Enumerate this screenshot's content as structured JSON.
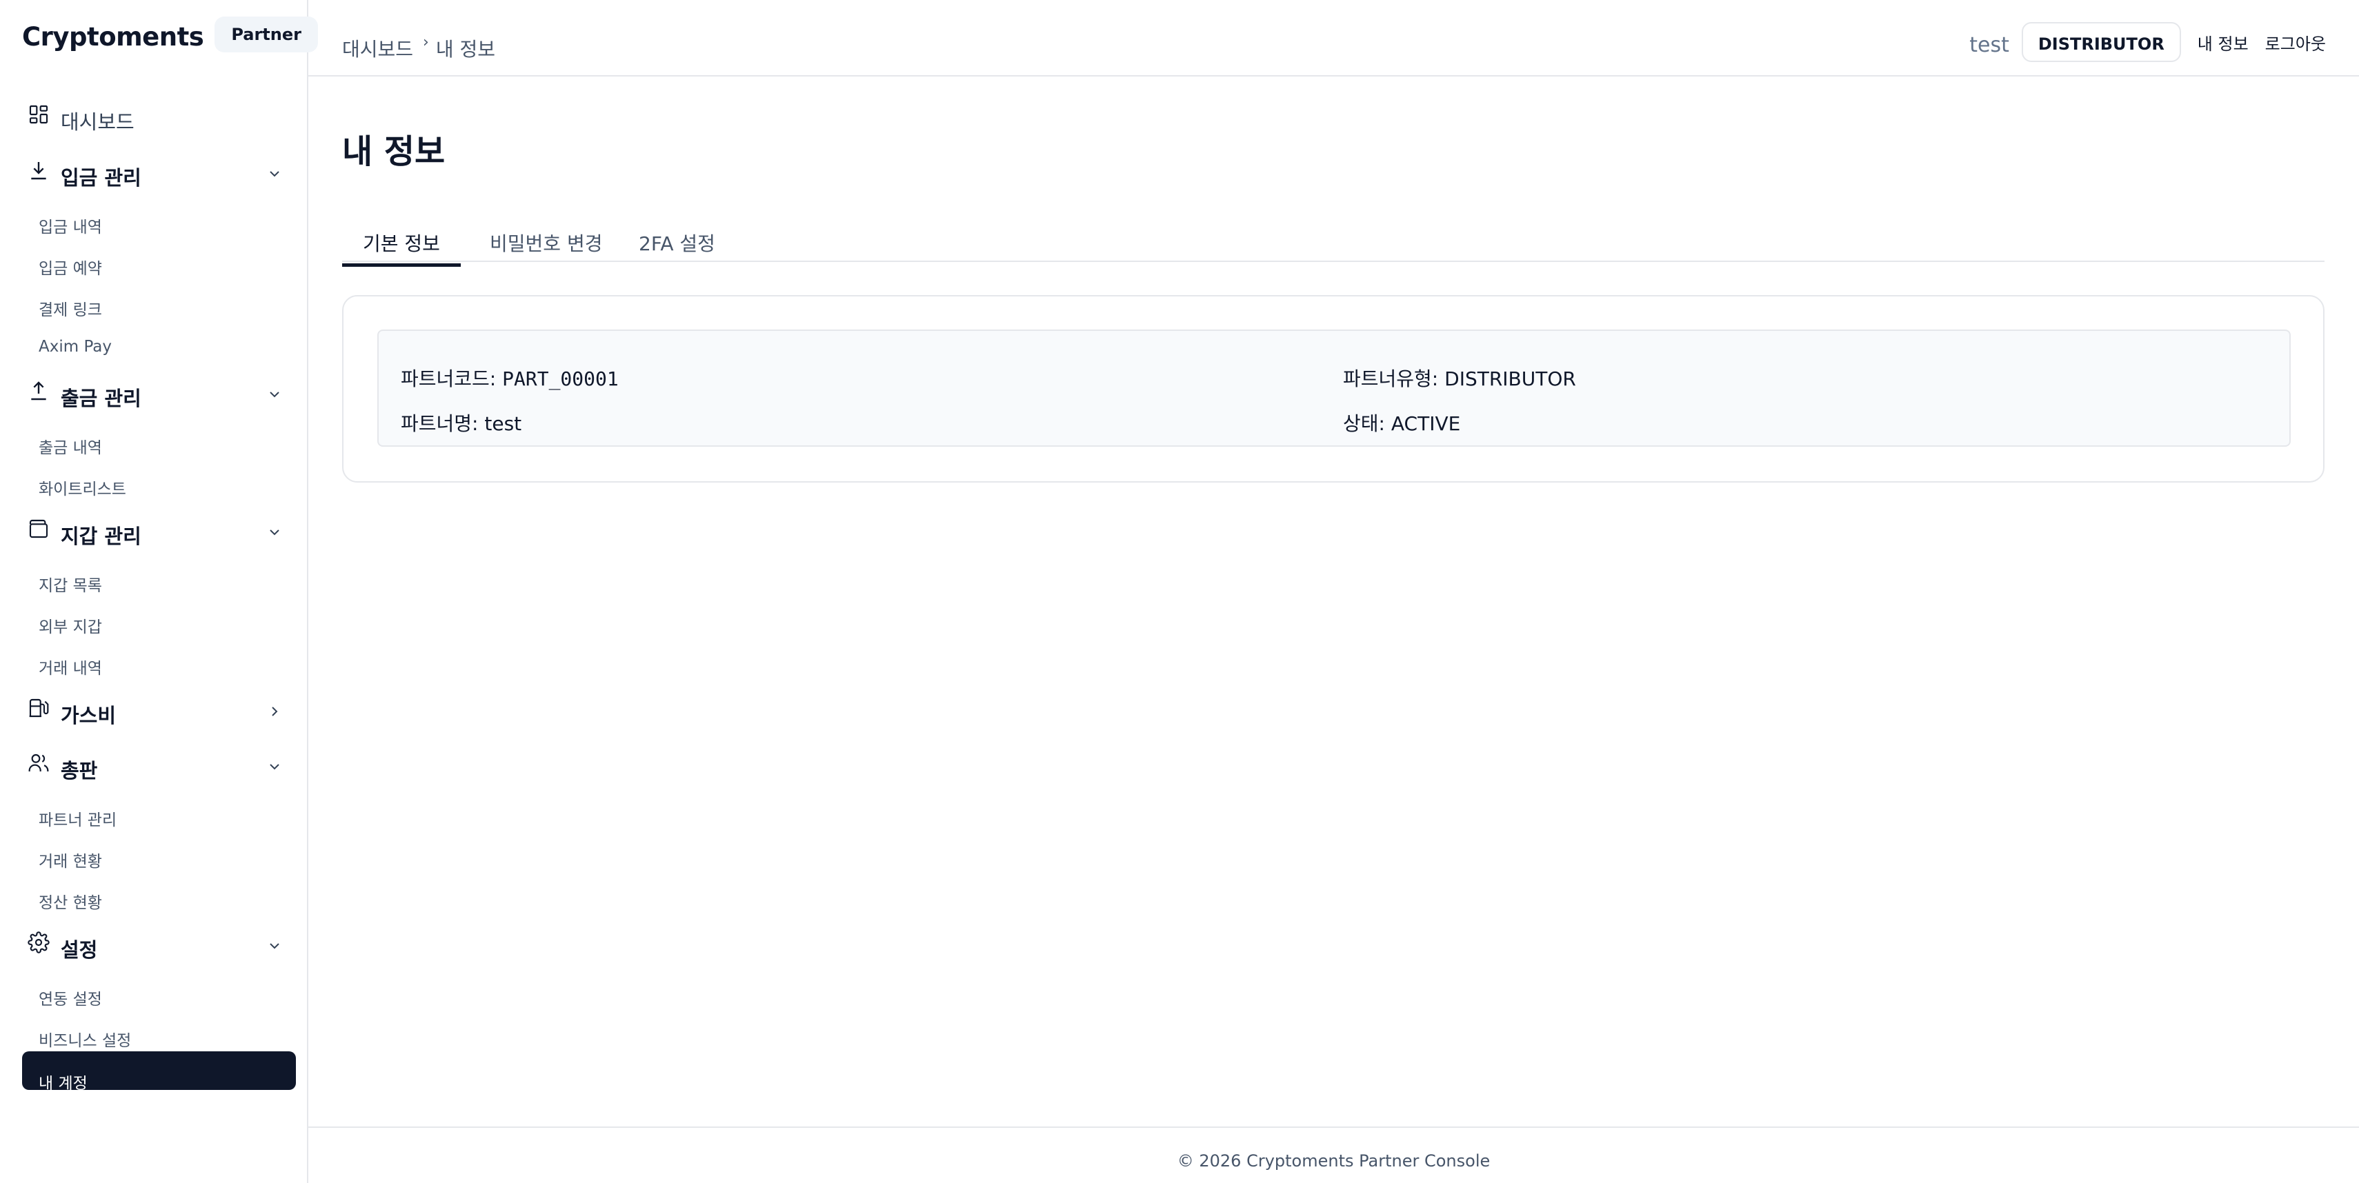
{
  "brand": {
    "name": "Cryptoments",
    "badge": "Partner"
  },
  "sidebar": {
    "dashboard": {
      "label": "대시보드",
      "icon": "dashboard-grid-icon"
    },
    "groups": [
      {
        "label": "입금 관리",
        "icon": "download-icon",
        "expanded": true,
        "items": [
          "입금 내역",
          "입금 예약",
          "결제 링크",
          "Axim Pay"
        ]
      },
      {
        "label": "출금 관리",
        "icon": "upload-icon",
        "expanded": true,
        "items": [
          "출금 내역",
          "화이트리스트"
        ]
      },
      {
        "label": "지갑 관리",
        "icon": "wallet-icon",
        "expanded": true,
        "items": [
          "지갑 목록",
          "외부 지갑",
          "거래 내역"
        ]
      },
      {
        "label": "가스비",
        "icon": "fuel-pump-icon",
        "expanded": false,
        "items": []
      },
      {
        "label": "총판",
        "icon": "users-icon",
        "expanded": true,
        "items": [
          "파트너 관리",
          "거래 현황",
          "정산 현황"
        ]
      },
      {
        "label": "설정",
        "icon": "gear-icon",
        "expanded": true,
        "items": [
          "연동 설정",
          "비즈니스 설정",
          "내 계정"
        ]
      }
    ],
    "active_item": "내 계정"
  },
  "header": {
    "breadcrumb": [
      "대시보드",
      "내 정보"
    ],
    "user": "test",
    "role": "DISTRIBUTOR",
    "my_info_link": "내 정보",
    "logout_link": "로그아웃"
  },
  "page": {
    "title": "내 정보",
    "tabs": [
      "기본 정보",
      "비밀번호 변경",
      "2FA 설정"
    ],
    "active_tab": "기본 정보",
    "info": {
      "code_label": "파트너코드:",
      "code_value": "PART_00001",
      "type_label": "파트너유형:",
      "type_value": "DISTRIBUTOR",
      "name_label": "파트너명:",
      "name_value": "test",
      "status_label": "상태:",
      "status_value": "ACTIVE"
    }
  },
  "footer": {
    "text": "© 2026 Cryptoments Partner Console"
  },
  "colors": {
    "primary": "#0f172a",
    "muted": "#475569",
    "border": "#e5e7eb",
    "panel": "#f8fafc"
  }
}
